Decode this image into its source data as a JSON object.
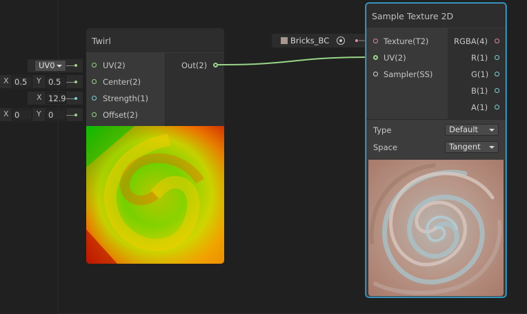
{
  "twirl_node": {
    "title": "Twirl",
    "inputs": [
      {
        "label": "UV(2)"
      },
      {
        "label": "Center(2)"
      },
      {
        "label": "Strength(1)"
      },
      {
        "label": "Offset(2)"
      }
    ],
    "output": {
      "label": "Out(2)"
    }
  },
  "inline_inputs": {
    "uv_channel": "UV0",
    "center": {
      "x_axis": "X",
      "x": "0.5",
      "y_axis": "Y",
      "y": "0.5"
    },
    "strength": {
      "x_axis": "X",
      "x": "12.9"
    },
    "offset": {
      "x_axis": "X",
      "x": "0",
      "y_axis": "Y",
      "y": "0"
    }
  },
  "property_node": {
    "label": "Bricks_BC"
  },
  "sample_node": {
    "title": "Sample Texture 2D",
    "inputs": [
      {
        "label": "Texture(T2)"
      },
      {
        "label": "UV(2)"
      },
      {
        "label": "Sampler(SS)"
      }
    ],
    "outputs": [
      {
        "label": "RGBA(4)"
      },
      {
        "label": "R(1)"
      },
      {
        "label": "G(1)"
      },
      {
        "label": "B(1)"
      },
      {
        "label": "A(1)"
      }
    ],
    "settings": {
      "type_label": "Type",
      "type_value": "Default",
      "space_label": "Space",
      "space_value": "Tangent"
    }
  },
  "colors": {
    "background": "#202020",
    "node_body": "#393939",
    "selection_outline": "#48b8e8",
    "vector_port": "#9ad68a",
    "float_port": "#7fd3e0",
    "texture_port": "#e58aa0"
  }
}
